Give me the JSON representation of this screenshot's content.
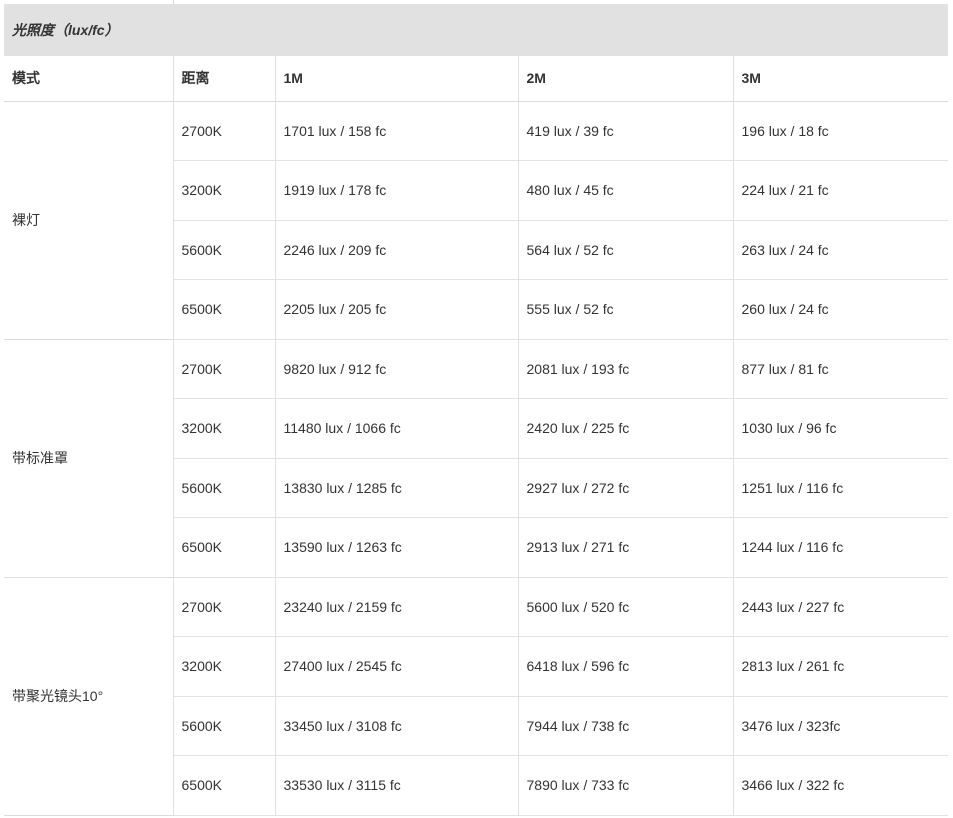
{
  "table": {
    "title": "光照度（lux/fc）",
    "headers": [
      "模式",
      "距离",
      "1M",
      "2M",
      "3M"
    ],
    "groups": [
      {
        "mode": "裸灯",
        "rows": [
          [
            "2700K",
            "1701 lux / 158 fc",
            "419 lux / 39 fc",
            "196 lux / 18 fc"
          ],
          [
            "3200K",
            "1919 lux / 178 fc",
            "480 lux / 45 fc",
            "224 lux / 21 fc"
          ],
          [
            "5600K",
            "2246 lux / 209 fc",
            "564 lux / 52 fc",
            "263 lux / 24 fc"
          ],
          [
            "6500K",
            "2205 lux / 205 fc",
            "555 lux / 52 fc",
            "260 lux / 24 fc"
          ]
        ]
      },
      {
        "mode": "带标准罩",
        "rows": [
          [
            "2700K",
            "9820 lux / 912 fc",
            "2081 lux / 193 fc",
            "877 lux / 81 fc"
          ],
          [
            "3200K",
            "11480 lux / 1066 fc",
            "2420 lux / 225 fc",
            "1030 lux / 96 fc"
          ],
          [
            "5600K",
            "13830 lux / 1285 fc",
            "2927 lux / 272 fc",
            "1251 lux / 116 fc"
          ],
          [
            "6500K",
            "13590 lux / 1263 fc",
            "2913 lux / 271 fc",
            "1244 lux / 116 fc"
          ]
        ]
      },
      {
        "mode": "带聚光镜头10°",
        "rows": [
          [
            "2700K",
            "23240 lux / 2159 fc",
            "5600 lux / 520 fc",
            "2443 lux / 227 fc"
          ],
          [
            "3200K",
            "27400 lux / 2545 fc",
            "6418 lux / 596 fc",
            "2813 lux / 261 fc"
          ],
          [
            "5600K",
            "33450 lux / 3108 fc",
            "7944 lux / 738 fc",
            "3476 lux / 323fc"
          ],
          [
            "6500K",
            "33530 lux / 3115 fc",
            "7890 lux / 733 fc",
            "3466 lux / 322 fc"
          ]
        ]
      }
    ]
  }
}
